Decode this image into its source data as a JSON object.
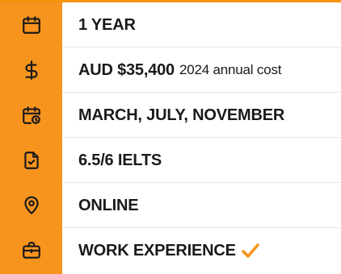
{
  "colors": {
    "accent": "#f7941d",
    "text": "#1a1a1a",
    "divider": "#e6e6e6"
  },
  "rows": [
    {
      "icon": "calendar-icon",
      "label": "1 YEAR"
    },
    {
      "icon": "dollar-icon",
      "label": "AUD $35,400",
      "sub": "2024 annual cost"
    },
    {
      "icon": "calendar-clock-icon",
      "label": "MARCH, JULY, NOVEMBER"
    },
    {
      "icon": "document-check-icon",
      "label": "6.5/6 IELTS"
    },
    {
      "icon": "location-pin-icon",
      "label": "ONLINE"
    },
    {
      "icon": "briefcase-icon",
      "label": "WORK EXPERIENCE",
      "badge_icon": "checkmark-icon"
    }
  ]
}
